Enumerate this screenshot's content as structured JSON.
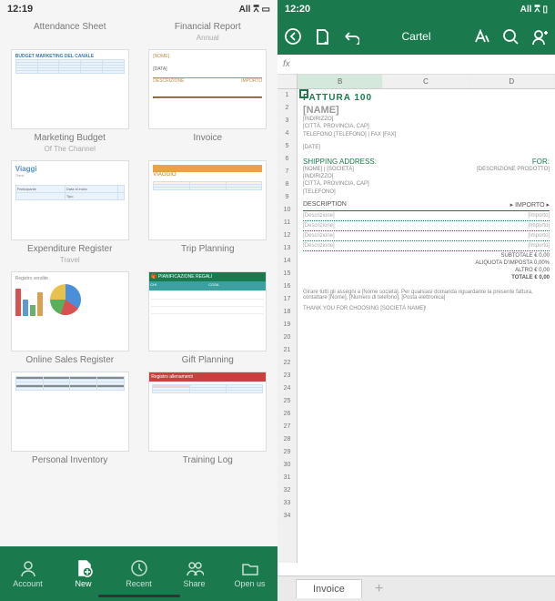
{
  "left": {
    "status": {
      "time": "12:19",
      "net": "All",
      "wifi": "�ω�",
      "batt": "▭"
    },
    "templates": [
      {
        "label": "Attendance Sheet",
        "sub": ""
      },
      {
        "label": "Financial Report",
        "sub": "Annual"
      },
      {
        "label": "Marketing Budget",
        "sub": "Of The Channel"
      },
      {
        "label": "Invoice",
        "sub": ""
      },
      {
        "label": "Expenditure Register",
        "sub": "Travel"
      },
      {
        "label": "Trip Planning",
        "sub": ""
      },
      {
        "label": "Online Sales Register",
        "sub": ""
      },
      {
        "label": "Gift Planning",
        "sub": ""
      },
      {
        "label": "Personal Inventory",
        "sub": ""
      },
      {
        "label": "Training Log",
        "sub": ""
      }
    ],
    "tabs": [
      {
        "label": "Account"
      },
      {
        "label": "New"
      },
      {
        "label": "Recent"
      },
      {
        "label": "Share"
      },
      {
        "label": "Open us"
      }
    ],
    "thumbs": {
      "budget_title": "BUDGET MARKETING DEL CANALE",
      "invoice_name": "[NOME]",
      "invoice_date": "[DATA]",
      "invoice_amt": "IMPORTO",
      "travel": "Viaggi",
      "trip": "VIAGGIO",
      "gift": "PIANIFICAZIONE REGALI",
      "log": "Registro allenamenti"
    }
  },
  "right": {
    "status": {
      "time": "12:20",
      "net": "All",
      "wifi": "⩞",
      "batt": "▭"
    },
    "appTitle": "Cartel",
    "fx": "fx",
    "cols": [
      "B",
      "C",
      "D"
    ],
    "rows": [
      "1",
      "2",
      "3",
      "4",
      "5",
      "6",
      "7",
      "8",
      "9",
      "10",
      "11",
      "12",
      "13",
      "14",
      "15",
      "16",
      "17",
      "18",
      "19",
      "20",
      "21",
      "22",
      "23",
      "24",
      "25",
      "26",
      "27",
      "28",
      "29",
      "30",
      "31",
      "32",
      "33",
      "34"
    ],
    "invoice": {
      "title": "FATTURA 100",
      "name": "[NAME]",
      "addr1": "[INDIRIZZO]",
      "addr2": "[CITTÀ, PROVINCIA, CAP]",
      "addr3": "TELEFONO [TELEFONO] | FAX [FAX]",
      "date": "[DATE]",
      "ship": "SHIPPING ADDRESS:",
      "for": "FOR:",
      "forDesc": "[DESCRIZIONE PRODOTTO]",
      "s1": "[NOME] | [SOCIETÀ]",
      "s2": "[INDIRIZZO]",
      "s3": "[CITTÀ, PROVINCIA, CAP]",
      "s4": "[TELEFONO]",
      "descHdr": "DESCRIPTION",
      "amtHdr": "IMPORTO",
      "rowDesc": "[Descrizione]",
      "rowAmt": "[Importo]",
      "subtotal": "SUBTOTALE   € 0,00",
      "tax": "ALIQUOTA D'IMPOSTA   0,00%",
      "other": "ALTRO   € 0,00",
      "total": "TOTALE   € 0,00",
      "note": "Girare tutti gli assegni a [Nome società]. Per qualsiasi domanda riguardante la presente fattura, contattare [Nome], [Numero di telefono], [Posta elettronica]",
      "thanks": "THANK YOU FOR CHOOSING [SOCIETÀ NAME]!"
    },
    "sheetTab": "Invoice",
    "plus": "+"
  }
}
